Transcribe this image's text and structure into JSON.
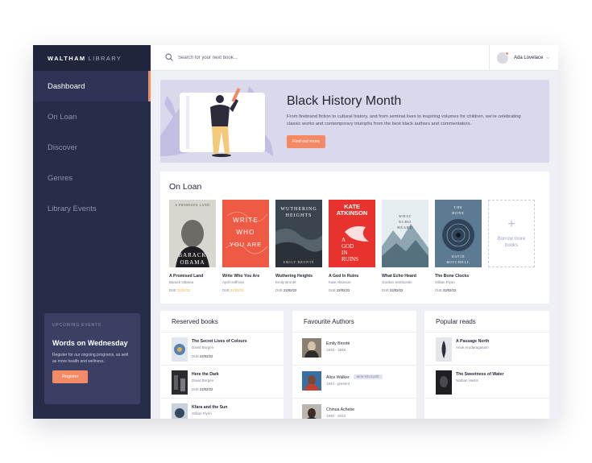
{
  "brand": {
    "name_bold": "WALTHAM",
    "name_light": "LIBRARY"
  },
  "sidebar": {
    "items": [
      {
        "label": "Dashboard"
      },
      {
        "label": "On Loan"
      },
      {
        "label": "Discover"
      },
      {
        "label": "Genres"
      },
      {
        "label": "Library Events"
      }
    ],
    "event": {
      "kicker": "UPCOMING EVENTS",
      "title": "Words on Wednesday",
      "description": "Register for our ongoing programs, as well as more health and wellness.",
      "button": "Register"
    }
  },
  "topbar": {
    "search_placeholder": "Search for your next book...",
    "user_name": "Ada Lovelace"
  },
  "hero": {
    "title": "Black History Month",
    "description": "From firebrand fiction to cultural history, and from seminal lives to inspiring volumes for children, we're celebrating classic works and contemporary triumphs from the best black authors and commentators.",
    "button": "Find out more"
  },
  "on_loan": {
    "title": "On Loan",
    "due_label": "DUE",
    "books": [
      {
        "title": "A Promised Land",
        "author": "Barack Obama",
        "due": "22/02/22",
        "overdue": true,
        "cover_top": "A PROMISED LAND",
        "cover_bottom1": "BARACK",
        "cover_bottom2": "OBAMA"
      },
      {
        "title": "Write Who You Are",
        "author": "April Hoffman",
        "due": "22/02/22",
        "overdue": true,
        "cover_lines": [
          "WRITE",
          "WHO",
          "YOU ARE"
        ]
      },
      {
        "title": "Wuthering Heights",
        "author": "Emily Brontë",
        "due": "22/02/22",
        "overdue": false,
        "cover_top": "WUTHERING",
        "cover_top2": "HEIGHTS",
        "cover_bottom1": "EMILY BRONTË"
      },
      {
        "title": "A God In Ruins",
        "author": "Kate Atkinson",
        "due": "22/02/22",
        "overdue": false,
        "cover_top": "KATE",
        "cover_top2": "ATKINSON",
        "cover_lines": [
          "A",
          "GOD",
          "IN",
          "RUINS"
        ]
      },
      {
        "title": "What Echo Heard",
        "author": "Gordon Semborski",
        "due": "22/02/22",
        "overdue": false,
        "cover_top": "WHAT",
        "cover_top2": "ECHO",
        "cover_top3": "HEARD"
      },
      {
        "title": "The Bone Clocks",
        "author": "Gillian Flynn",
        "due": "22/02/22",
        "overdue": false,
        "cover_top": "THE",
        "cover_top2": "BONE",
        "cover_bottom1": "DAVID",
        "cover_bottom2": "MITCHELL"
      }
    ],
    "borrow_label": "Borrow more books"
  },
  "reserved": {
    "title": "Reserved books",
    "due_label": "DUE",
    "items": [
      {
        "title": "The Secret Lives of Colours",
        "author": "David Borgen",
        "due": "22/02/22"
      },
      {
        "title": "Here the Dark",
        "author": "David Borgen",
        "due": "22/02/22"
      },
      {
        "title": "Kfara and the Sun",
        "author": "Gillian Flynn",
        "due": ""
      }
    ]
  },
  "authors": {
    "title": "Favourite Authors",
    "items": [
      {
        "name": "Emily Brontë",
        "years": "1818 - 1848",
        "badge": ""
      },
      {
        "name": "Alice Walker",
        "years": "1944 - present",
        "badge": "NEW RELEASE"
      },
      {
        "name": "Chinua Achebe",
        "years": "1930 - 2013",
        "badge": ""
      }
    ]
  },
  "popular": {
    "title": "Popular reads",
    "items": [
      {
        "title": "A Passage North",
        "author": "Anuk Arudpragasam"
      },
      {
        "title": "The Sweetness of Water",
        "author": "Nathan Harris"
      }
    ]
  },
  "colors": {
    "sidebar": "#272c48",
    "accent": "#f48966",
    "hero_bg": "#dad9ec",
    "overdue": "#f2a93b"
  },
  "icons": [
    "search-icon",
    "chevron-down-icon",
    "plus-icon"
  ]
}
